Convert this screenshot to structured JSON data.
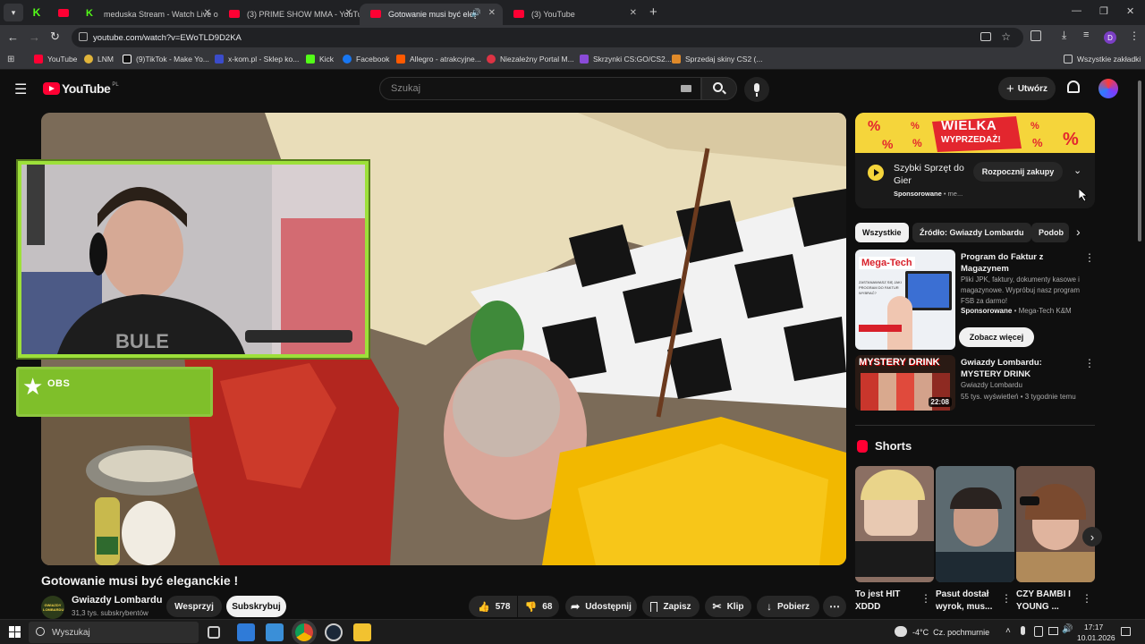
{
  "browser": {
    "tabs": [
      {
        "label": "meduska Stream - Watch Live o",
        "fav_color": "#53fc18"
      },
      {
        "label": "(3) PRIME SHOW MMA - YouTu",
        "fav_color": "#ff0033"
      },
      {
        "label": "Gotowanie musi być elegan",
        "fav_color": "#ff0033",
        "active": true
      },
      {
        "label": "(3) YouTube",
        "fav_color": "#ff0033"
      }
    ],
    "url": "youtube.com/watch?v=EWoTLD9D2KA",
    "bookmarks": [
      {
        "label": "YouTube",
        "color": "#ff0033"
      },
      {
        "label": "LNM",
        "color": "#e0b43a"
      },
      {
        "label": "(9)TikTok - Make Yo...",
        "color": "#111111"
      },
      {
        "label": "x-kom.pl - Sklep ko...",
        "color": "#3b4cca"
      },
      {
        "label": "Kick",
        "color": "#53fc18"
      },
      {
        "label": "Facebook",
        "color": "#1877f2"
      },
      {
        "label": "Allegro - atrakcyjne...",
        "color": "#ff5a00"
      },
      {
        "label": "Niezależny Portal M...",
        "color": "#dd3344"
      },
      {
        "label": "Skrzynki CS:GO/CS2...",
        "color": "#8a4bd8"
      },
      {
        "label": "Sprzedaj skiny CS2 (...",
        "color": "#e08a2a"
      }
    ],
    "all_bookmarks": "Wszystkie zakładki"
  },
  "yt": {
    "logo": "YouTube",
    "region": "PL",
    "search_placeholder": "Szukaj",
    "create": "Utwórz"
  },
  "video": {
    "obs_label": "OBS",
    "title": "Gotowanie musi być eleganckie !",
    "channel": "Gwiazdy Lombardu",
    "subscribers": "31,3 tys. subskrybentów",
    "avatar_text": "GWIAZDY LOMBARDU",
    "support": "Wesprzyj",
    "subscribe": "Subskrybuj",
    "likes": "578",
    "dislikes": "68",
    "share": "Udostępnij",
    "save": "Zapisz",
    "clip": "Klip",
    "download": "Pobierz"
  },
  "ad": {
    "banner_text_1": "WIELKA",
    "banner_text_2": "WYPRZEDAŻ!",
    "title": "Szybki Sprzęt do Gier",
    "sponsored": "Sponsorowane",
    "sponsored_suffix": " • me...",
    "cta": "Rozpocznij zakupy"
  },
  "chips": [
    "Wszystkie",
    "Źródło: Gwiazdy Lombardu",
    "Podob"
  ],
  "related": [
    {
      "title": "Program do Faktur z Magazynem",
      "desc": "Pliki JPK, faktury, dokumenty kasowe i magazynowe. Wypróbuj nasz program FSB za darmo!",
      "sponsored": "Sponsorowane",
      "advertiser": " • Mega-Tech K&M",
      "thumb_brand": "Mega-Tech",
      "thumb_caption": "ZASTANAWIASZ SIĘ JAKI PROGRAM DO FAKTUR WYBRAĆ?",
      "cta": "Zobacz więcej"
    },
    {
      "title": "Gwiazdy Lombardu: MYSTERY DRINK",
      "channel": "Gwiazdy Lombardu",
      "meta": "55 tys. wyświetleń • 3 tygodnie temu",
      "thumb_text": "MYSTERY DRINK",
      "duration": "22:08"
    }
  ],
  "shorts": {
    "heading": "Shorts",
    "items": [
      {
        "title": "To jest HIT XDDD",
        "color": "#8b6f63"
      },
      {
        "title": "Pasut dostał wyrok, mus...",
        "color": "#5c6a70"
      },
      {
        "title": "CZY BAMBI I YOUNG ...",
        "color": "#6b5044"
      }
    ]
  },
  "taskbar": {
    "search": "Wyszukaj",
    "weather": "-4°C  Cz. pochmurnie",
    "time": "17:17",
    "date": "10.01.2026"
  }
}
